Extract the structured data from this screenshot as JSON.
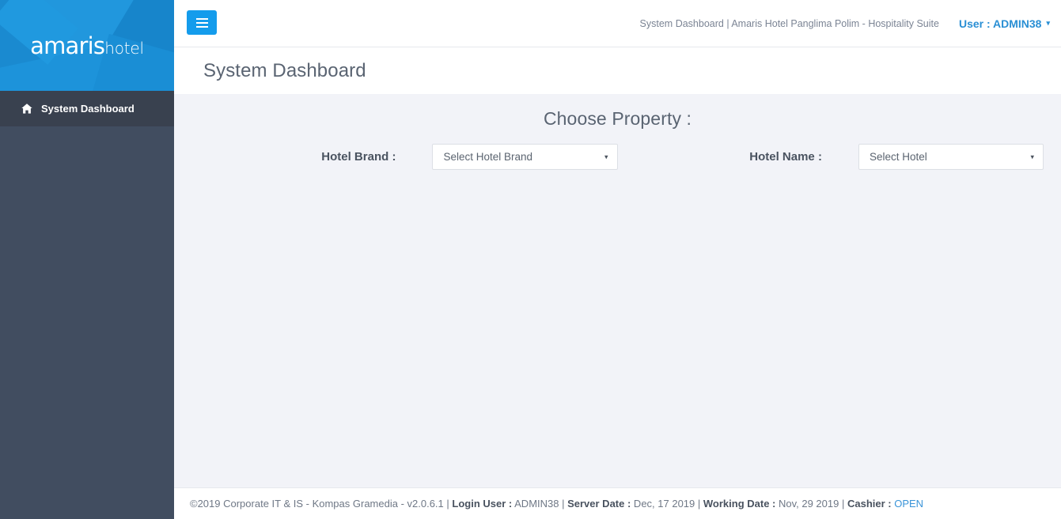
{
  "sidebar": {
    "logo": {
      "main": "amaris",
      "sub": "hotel"
    },
    "items": [
      {
        "label": "System Dashboard",
        "icon": "home-icon",
        "active": true
      }
    ]
  },
  "header": {
    "menu_toggle_icon": "hamburger-icon",
    "context_text": "System Dashboard | Amaris Hotel Panglima Polim - Hospitality Suite",
    "user_label": "User : ADMIN38",
    "user_caret_icon": "chevron-down-icon",
    "user_caret": "▾"
  },
  "page": {
    "title": "System Dashboard"
  },
  "main": {
    "section_title": "Choose Property :",
    "fields": [
      {
        "label": "Hotel Brand :",
        "value": "Select Hotel Brand",
        "caret": "▾"
      },
      {
        "label": "Hotel Name :",
        "value": "Select Hotel",
        "caret": "▾"
      }
    ]
  },
  "footer": {
    "copyright": "©2019 Corporate IT & IS - Kompas Gramedia - v2.0.6.1",
    "sep1": " | ",
    "login_user_label": "Login User :",
    "login_user_value": " ADMIN38 ",
    "sep2": "| ",
    "server_date_label": "Server Date :",
    "server_date_value": " Dec, 17 2019 ",
    "sep3": "| ",
    "working_date_label": "Working Date :",
    "working_date_value": " Nov, 29 2019 ",
    "sep4": "| ",
    "cashier_label": "Cashier :",
    "cashier_value": " OPEN"
  },
  "colors": {
    "brand_blue": "#1b8fd6",
    "accent_blue": "#149cec",
    "sidebar": "#414d60",
    "sidebar_active": "#39414f",
    "content_bg": "#f2f3f8",
    "link_blue": "#2a8fd4"
  }
}
